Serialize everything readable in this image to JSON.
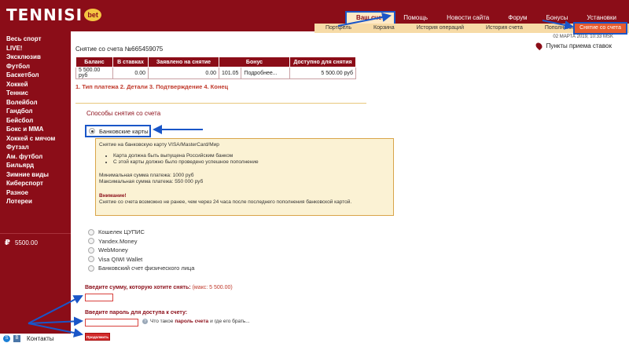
{
  "logo": {
    "text": "TENNISI",
    "badge": "bet"
  },
  "topnav": {
    "items": [
      {
        "label": "Ваш счет",
        "active": true
      },
      {
        "label": "Помощь"
      },
      {
        "label": "Новости сайта"
      },
      {
        "label": "Форум"
      },
      {
        "label": "Бонусы"
      },
      {
        "label": "Установки"
      }
    ]
  },
  "subnav": {
    "items": [
      "Портфель",
      "Корзина",
      "История операций",
      "История счета",
      "Пополнение"
    ],
    "active": "Снятие со счета"
  },
  "sidebar": {
    "items": [
      "Весь спорт",
      "LIVE!",
      "Эксклюзив",
      "Футбол",
      "Баскетбол",
      "Хоккей",
      "Теннис",
      "Волейбол",
      "Гандбол",
      "Бейсбол",
      "Бокс и ММА",
      "Хоккей с мячом",
      "Футзал",
      "Ам. футбол",
      "Бильярд",
      "Зимние виды",
      "Киберспорт",
      "Разное",
      "Лотереи"
    ],
    "balance": "5500.00",
    "balance_symbol": "₽",
    "contacts": "Контакты"
  },
  "main": {
    "date": "02 МАРТА 2019, 10:33 МSK",
    "points": "Пункты приема ставок",
    "title": "Снятие со счета №665459075",
    "table": {
      "headers": [
        "Баланс",
        "В ставках",
        "Заявлено на снятие",
        "Бонус",
        "Доступно для снятия"
      ],
      "row": [
        "5 500.00 руб",
        "0.00",
        "0.00",
        "101.05",
        "Подробнее...",
        "5 500.00 руб"
      ]
    },
    "steps": "1. Тип платежа 2. Детали 3. Подтверждение 4. Конец",
    "methods_title": "Способы снятия со счета",
    "bank_card": "Банковские карты",
    "info": {
      "line1": "Снятие на банковскую карту VISA/MasterCard/Мир",
      "bullets": [
        "Карта должна быть выпущена Российским банком",
        "С этой карты должно было проведено успешное пополнение"
      ],
      "min": "Минимальная сумма платежа: 1000 руб",
      "max": "Максимальная сумма платежа: 550 000 руб",
      "warn_title": "Внимание!",
      "warn_text": "Снятие со счета возможно не ранее, чем через 24 часа после последнего пополнения банковской картой."
    },
    "methods": [
      "Кошелек ЦУПИС",
      "Yandex.Money",
      "WebMoney",
      "Visa QIWI Wallet",
      "Банковский счет физического лица"
    ],
    "amount_label": "Введите сумму, которую хотите снять:",
    "amount_max": "(макс: 5 500.00)",
    "password_label": "Введите пароль для доступа к счету:",
    "help_prefix": "Что такое",
    "help_bold": "пароль счета",
    "help_suffix": "и где его брать...",
    "submit": "Продолжить"
  },
  "colors": {
    "brand": "#8b0d18",
    "accent": "#f7dba7",
    "annotation": "#1a56c8"
  }
}
